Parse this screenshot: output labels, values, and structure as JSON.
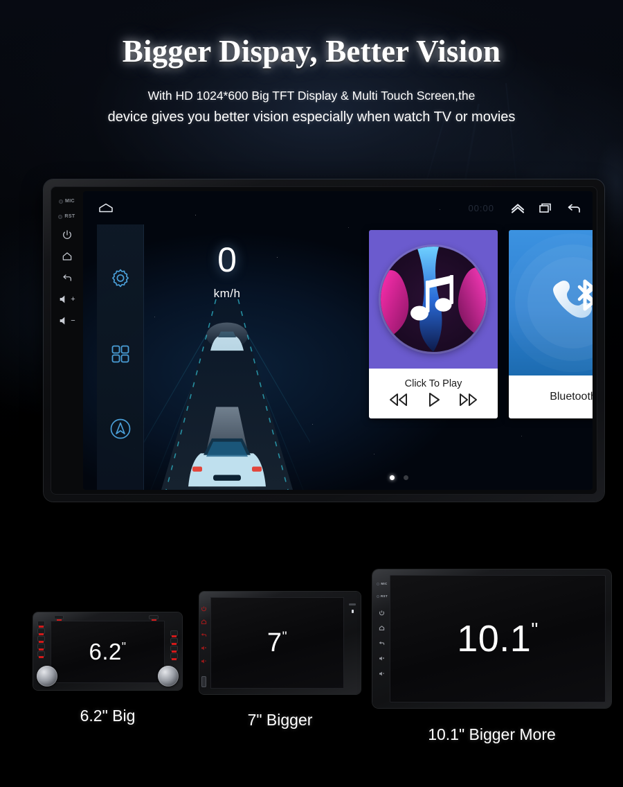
{
  "header": {
    "headline": "Bigger Dispay, Better Vision",
    "sub_line_1": "With HD 1024*600 Big TFT Display & Multi Touch Screen,the",
    "sub_line_2": "device gives you better vision especially when watch TV or movies"
  },
  "device": {
    "bezel_keys": [
      {
        "name": "mic",
        "label": "MIC",
        "type": "pinhole"
      },
      {
        "name": "reset",
        "label": "RST",
        "type": "pinhole"
      },
      {
        "name": "power",
        "label": "",
        "type": "icon"
      },
      {
        "name": "home",
        "label": "",
        "type": "icon"
      },
      {
        "name": "back",
        "label": "",
        "type": "icon"
      },
      {
        "name": "volume-up",
        "label": "+",
        "type": "icon"
      },
      {
        "name": "volume-down",
        "label": "−",
        "type": "icon"
      }
    ],
    "statusbar": {
      "home_icon": "home-icon",
      "clock": "00:00",
      "icons": [
        "chevron-up-icon",
        "recents-icon",
        "back-icon"
      ]
    },
    "sidebar_icons": [
      "settings-gear-icon",
      "apps-grid-icon",
      "navigation-icon"
    ],
    "speedometer": {
      "value": "0",
      "unit": "km/h"
    },
    "cards": [
      {
        "id": "music",
        "label": "Click To Play",
        "art": "music-note-icon",
        "accent": "#6B5BCE",
        "controls": [
          "previous-track-icon",
          "play-icon",
          "next-track-icon"
        ]
      },
      {
        "id": "bluetooth",
        "label": "Bluetooth",
        "art": "bluetooth-phone-icon",
        "accent": "#3C92E0",
        "accent_bottom": "#1C6BB0",
        "controls": []
      }
    ],
    "page_dots": {
      "count": 2,
      "active_index": 0
    }
  },
  "comparison": {
    "units": [
      {
        "id": "u62",
        "screen_text": "6.2",
        "inch_mark": "\"",
        "label": "6.2\" Big"
      },
      {
        "id": "u7",
        "screen_text": "7",
        "inch_mark": "\"",
        "label": "7\" Bigger"
      },
      {
        "id": "u101",
        "screen_text": "10.1",
        "inch_mark": "\"",
        "label": "10.1\" Bigger More"
      }
    ]
  },
  "colors": {
    "background": "#000000",
    "headline_text": "#ffffff",
    "music_purple": "#6B5BCE",
    "bluetooth_blue": "#3C92E0",
    "sidebar_icon_blue": "#4A9FD8",
    "screen_navy": "#061325"
  }
}
